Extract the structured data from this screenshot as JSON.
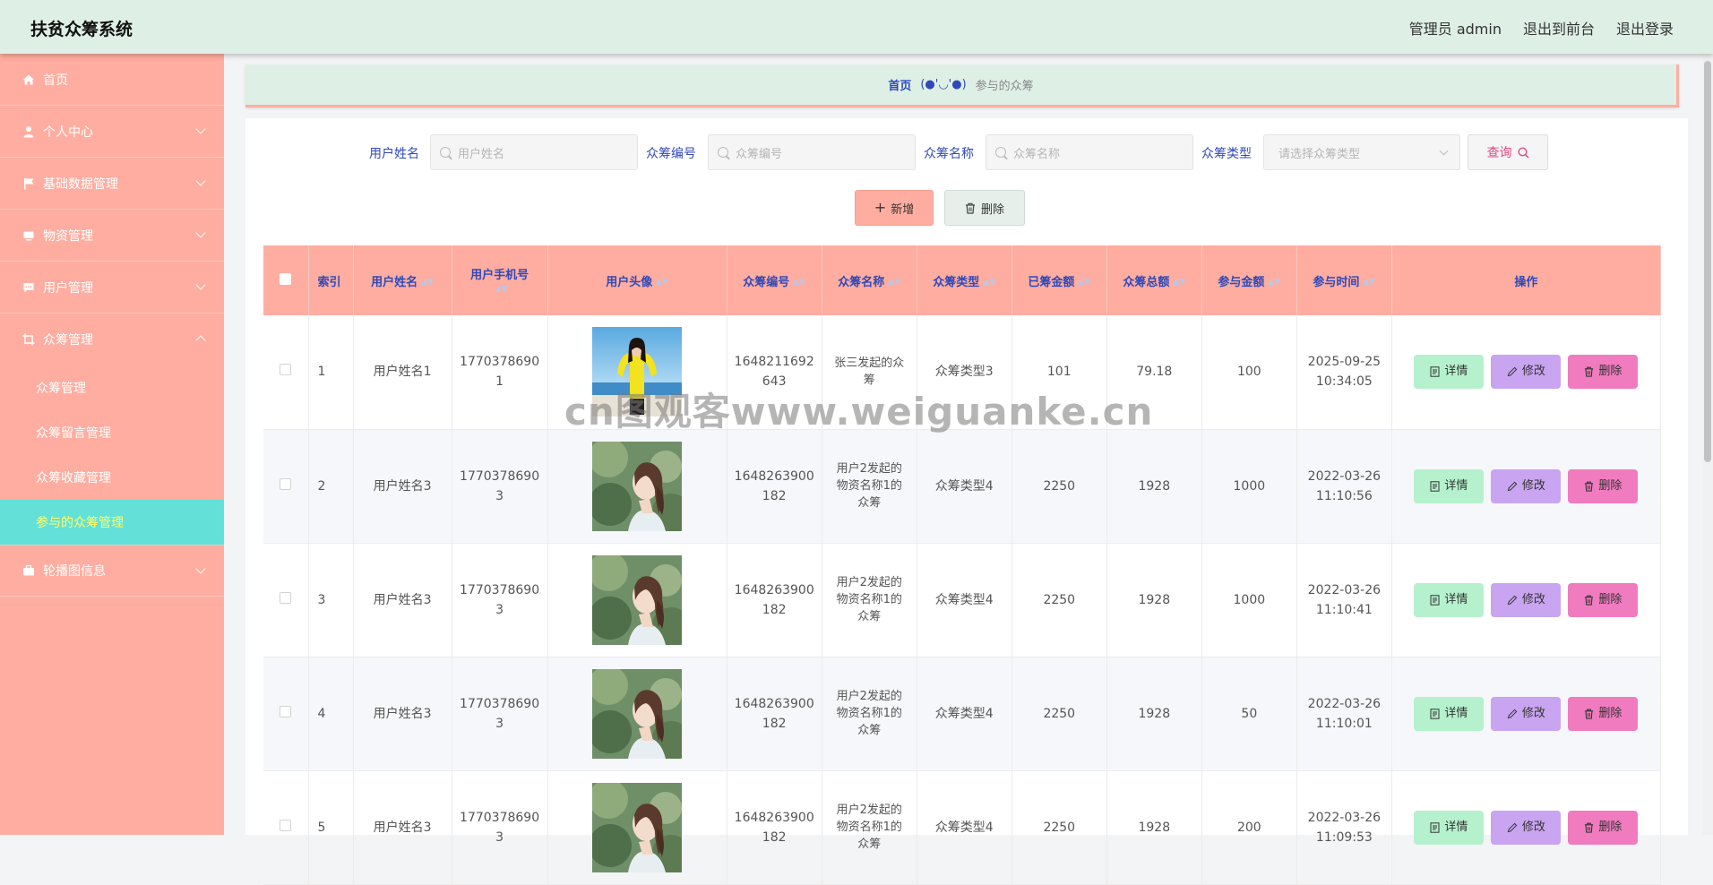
{
  "app": {
    "title": "扶贫众筹系统",
    "user_label": "管理员 admin",
    "to_front": "退出到前台",
    "logout": "退出登录"
  },
  "sidebar": {
    "items": [
      {
        "label": "首页",
        "icon": "home-icon"
      },
      {
        "label": "个人中心",
        "icon": "user-icon"
      },
      {
        "label": "基础数据管理",
        "icon": "flag-icon"
      },
      {
        "label": "物资管理",
        "icon": "box-icon"
      },
      {
        "label": "用户管理",
        "icon": "chat-icon"
      },
      {
        "label": "众筹管理",
        "icon": "crop-icon"
      },
      {
        "label": "轮播图信息",
        "icon": "briefcase-icon"
      }
    ],
    "submenu": [
      {
        "label": "众筹管理"
      },
      {
        "label": "众筹留言管理"
      },
      {
        "label": "众筹收藏管理"
      },
      {
        "label": "参与的众筹管理"
      }
    ]
  },
  "breadcrumb": {
    "home": "首页",
    "emoji": "(●'◡'●)",
    "current": "参与的众筹"
  },
  "search": {
    "username_label": "用户姓名",
    "username_placeholder": "用户姓名",
    "code_label": "众筹编号",
    "code_placeholder": "众筹编号",
    "name_label": "众筹名称",
    "name_placeholder": "众筹名称",
    "type_label": "众筹类型",
    "type_placeholder": "请选择众筹类型",
    "query_button": "查询"
  },
  "actions": {
    "add": "新增",
    "delete": "删除"
  },
  "table": {
    "headers": {
      "index": "索引",
      "username": "用户姓名",
      "phone": "用户手机号",
      "avatar": "用户头像",
      "code": "众筹编号",
      "name": "众筹名称",
      "type": "众筹类型",
      "raised": "已筹金额",
      "total": "众筹总额",
      "amount": "参与金额",
      "time": "参与时间",
      "ops": "操作"
    },
    "op_labels": {
      "detail": "详情",
      "edit": "修改",
      "del": "删除"
    },
    "rows": [
      {
        "index": "1",
        "username": "用户姓名1",
        "phone_a": "1770378690",
        "phone_b": "1",
        "code_a": "1648211692",
        "code_b": "643",
        "name_a": "张三发起的众",
        "name_b": "筹",
        "name_c": "",
        "type": "众筹类型3",
        "raised": "101",
        "total": "79.18",
        "amount": "100",
        "date": "2025-09-25",
        "clock": "10:34:05",
        "avatar": "yellow-girl-photo"
      },
      {
        "index": "2",
        "username": "用户姓名3",
        "phone_a": "1770378690",
        "phone_b": "3",
        "code_a": "1648263900",
        "code_b": "182",
        "name_a": "用户2发起的",
        "name_b": "物资名称1的",
        "name_c": "众筹",
        "type": "众筹类型4",
        "raised": "2250",
        "total": "1928",
        "amount": "1000",
        "date": "2022-03-26",
        "clock": "11:10:56",
        "avatar": "profile-girl-photo"
      },
      {
        "index": "3",
        "username": "用户姓名3",
        "phone_a": "1770378690",
        "phone_b": "3",
        "code_a": "1648263900",
        "code_b": "182",
        "name_a": "用户2发起的",
        "name_b": "物资名称1的",
        "name_c": "众筹",
        "type": "众筹类型4",
        "raised": "2250",
        "total": "1928",
        "amount": "1000",
        "date": "2022-03-26",
        "clock": "11:10:41",
        "avatar": "profile-girl-photo"
      },
      {
        "index": "4",
        "username": "用户姓名3",
        "phone_a": "1770378690",
        "phone_b": "3",
        "code_a": "1648263900",
        "code_b": "182",
        "name_a": "用户2发起的",
        "name_b": "物资名称1的",
        "name_c": "众筹",
        "type": "众筹类型4",
        "raised": "2250",
        "total": "1928",
        "amount": "50",
        "date": "2022-03-26",
        "clock": "11:10:01",
        "avatar": "profile-girl-photo"
      },
      {
        "index": "5",
        "username": "用户姓名3",
        "phone_a": "1770378690",
        "phone_b": "3",
        "code_a": "1648263900",
        "code_b": "182",
        "name_a": "用户2发起的",
        "name_b": "物资名称1的",
        "name_c": "众筹",
        "type": "众筹类型4",
        "raised": "2250",
        "total": "1928",
        "amount": "200",
        "date": "2022-03-26",
        "clock": "11:09:53",
        "avatar": "profile-girl-photo"
      }
    ]
  },
  "watermark": "cn图观客www.weiguanke.cn",
  "colors": {
    "sidebar": "#ffada0",
    "topbar": "#deefe6",
    "active_sub": "#63e0d8",
    "label_blue": "#2f49b8",
    "detail_btn": "#b4f1cc",
    "edit_btn": "#c9a4f0",
    "delete_btn": "#f07bbf"
  }
}
